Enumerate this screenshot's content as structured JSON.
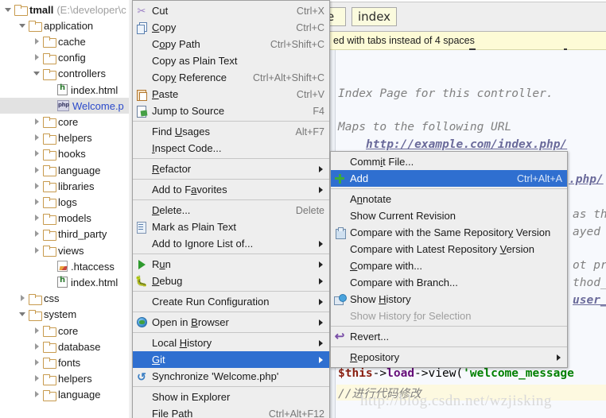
{
  "editor": {
    "tabs": [
      {
        "label": "e",
        "name": "tab-welcome-partial"
      },
      {
        "label": "index",
        "name": "tab-index"
      }
    ],
    "warning_strip": "ed with tabs instead of 4 spaces",
    "code_lines": [
      {
        "text": "Index Page for this controller.",
        "style": "plain"
      },
      {
        "text": "Maps to the following URL",
        "style": "plain"
      },
      {
        "text": "http://example.com/index.php/",
        "style": "link"
      },
      {
        "text": ".php/",
        "style": "link"
      },
      {
        "text": "as the",
        "style": "plain"
      },
      {
        "text": "ayed c",
        "style": "plain"
      },
      {
        "text": "ot pre",
        "style": "plain"
      },
      {
        "text": "thod_",
        "style": "plain"
      },
      {
        "text": "user_",
        "style": "link"
      }
    ],
    "php_code": {
      "var": "$this",
      "arrow1": "->",
      "kw": "load",
      "arrow2": "->",
      "method": "view(",
      "string": "'welcome_message"
    },
    "comment": "//进行代码修改",
    "watermark": "http://blog.csdn.net/wzjisking"
  },
  "tree": {
    "items": [
      {
        "indent": 0,
        "twisty": "open",
        "icon": "folder-icon",
        "label": "tmall",
        "path": "(E:\\developer\\c",
        "bold": true,
        "selected": false
      },
      {
        "indent": 1,
        "twisty": "open",
        "icon": "folder-icon",
        "label": "application",
        "path": "",
        "bold": false,
        "selected": false
      },
      {
        "indent": 2,
        "twisty": "closed",
        "icon": "folder-icon",
        "label": "cache",
        "path": "",
        "bold": false,
        "selected": false
      },
      {
        "indent": 2,
        "twisty": "closed",
        "icon": "folder-icon",
        "label": "config",
        "path": "",
        "bold": false,
        "selected": false
      },
      {
        "indent": 2,
        "twisty": "open",
        "icon": "folder-icon",
        "label": "controllers",
        "path": "",
        "bold": false,
        "selected": false
      },
      {
        "indent": 3,
        "twisty": "none",
        "icon": "html-file-icon",
        "label": "index.html",
        "path": "",
        "bold": false,
        "selected": false
      },
      {
        "indent": 3,
        "twisty": "none",
        "icon": "php-file-icon",
        "label": "Welcome.p",
        "path": "",
        "bold": false,
        "selected": true
      },
      {
        "indent": 2,
        "twisty": "closed",
        "icon": "folder-icon",
        "label": "core",
        "path": "",
        "bold": false,
        "selected": false
      },
      {
        "indent": 2,
        "twisty": "closed",
        "icon": "folder-icon",
        "label": "helpers",
        "path": "",
        "bold": false,
        "selected": false
      },
      {
        "indent": 2,
        "twisty": "closed",
        "icon": "folder-icon",
        "label": "hooks",
        "path": "",
        "bold": false,
        "selected": false
      },
      {
        "indent": 2,
        "twisty": "closed",
        "icon": "folder-icon",
        "label": "language",
        "path": "",
        "bold": false,
        "selected": false
      },
      {
        "indent": 2,
        "twisty": "closed",
        "icon": "folder-icon",
        "label": "libraries",
        "path": "",
        "bold": false,
        "selected": false
      },
      {
        "indent": 2,
        "twisty": "closed",
        "icon": "folder-icon",
        "label": "logs",
        "path": "",
        "bold": false,
        "selected": false
      },
      {
        "indent": 2,
        "twisty": "closed",
        "icon": "folder-icon",
        "label": "models",
        "path": "",
        "bold": false,
        "selected": false
      },
      {
        "indent": 2,
        "twisty": "closed",
        "icon": "folder-icon",
        "label": "third_party",
        "path": "",
        "bold": false,
        "selected": false
      },
      {
        "indent": 2,
        "twisty": "closed",
        "icon": "folder-icon",
        "label": "views",
        "path": "",
        "bold": false,
        "selected": false
      },
      {
        "indent": 3,
        "twisty": "none",
        "icon": "htaccess-file-icon",
        "label": ".htaccess",
        "path": "",
        "bold": false,
        "selected": false
      },
      {
        "indent": 3,
        "twisty": "none",
        "icon": "html-file-icon",
        "label": "index.html",
        "path": "",
        "bold": false,
        "selected": false
      },
      {
        "indent": 1,
        "twisty": "closed",
        "icon": "folder-icon",
        "label": "css",
        "path": "",
        "bold": false,
        "selected": false
      },
      {
        "indent": 1,
        "twisty": "open",
        "icon": "folder-icon",
        "label": "system",
        "path": "",
        "bold": false,
        "selected": false
      },
      {
        "indent": 2,
        "twisty": "closed",
        "icon": "folder-icon",
        "label": "core",
        "path": "",
        "bold": false,
        "selected": false
      },
      {
        "indent": 2,
        "twisty": "closed",
        "icon": "folder-icon",
        "label": "database",
        "path": "",
        "bold": false,
        "selected": false
      },
      {
        "indent": 2,
        "twisty": "closed",
        "icon": "folder-icon",
        "label": "fonts",
        "path": "",
        "bold": false,
        "selected": false
      },
      {
        "indent": 2,
        "twisty": "closed",
        "icon": "folder-icon",
        "label": "helpers",
        "path": "",
        "bold": false,
        "selected": false
      },
      {
        "indent": 2,
        "twisty": "closed",
        "icon": "folder-icon",
        "label": "language",
        "path": "",
        "bold": false,
        "selected": false
      }
    ]
  },
  "context_menu": {
    "items": [
      {
        "type": "item",
        "label": "Cut",
        "mnemonic": "",
        "shortcut": "Ctrl+X",
        "icon": "scissors-icon",
        "submenu": false,
        "highlight": false,
        "disabled": false
      },
      {
        "type": "item",
        "label": "Copy",
        "mnemonic": "C",
        "shortcut": "Ctrl+C",
        "icon": "copy-icon",
        "submenu": false,
        "highlight": false,
        "disabled": false
      },
      {
        "type": "item",
        "label": "Copy Path",
        "mnemonic": "o",
        "shortcut": "Ctrl+Shift+C",
        "icon": "",
        "submenu": false,
        "highlight": false,
        "disabled": false
      },
      {
        "type": "item",
        "label": "Copy as Plain Text",
        "mnemonic": "",
        "shortcut": "",
        "icon": "",
        "submenu": false,
        "highlight": false,
        "disabled": false
      },
      {
        "type": "item",
        "label": "Copy Reference",
        "mnemonic": "y",
        "shortcut": "Ctrl+Alt+Shift+C",
        "icon": "",
        "submenu": false,
        "highlight": false,
        "disabled": false
      },
      {
        "type": "item",
        "label": "Paste",
        "mnemonic": "P",
        "shortcut": "Ctrl+V",
        "icon": "paste-icon",
        "submenu": false,
        "highlight": false,
        "disabled": false
      },
      {
        "type": "item",
        "label": "Jump to Source",
        "mnemonic": "",
        "shortcut": "F4",
        "icon": "jump-to-source-icon",
        "submenu": false,
        "highlight": false,
        "disabled": false
      },
      {
        "type": "separator"
      },
      {
        "type": "item",
        "label": "Find Usages",
        "mnemonic": "U",
        "shortcut": "Alt+F7",
        "icon": "",
        "submenu": false,
        "highlight": false,
        "disabled": false
      },
      {
        "type": "item",
        "label": "Inspect Code...",
        "mnemonic": "I",
        "shortcut": "",
        "icon": "",
        "submenu": false,
        "highlight": false,
        "disabled": false
      },
      {
        "type": "separator"
      },
      {
        "type": "item",
        "label": "Refactor",
        "mnemonic": "R",
        "shortcut": "",
        "icon": "",
        "submenu": true,
        "highlight": false,
        "disabled": false
      },
      {
        "type": "separator"
      },
      {
        "type": "item",
        "label": "Add to Favorites",
        "mnemonic": "a",
        "shortcut": "",
        "icon": "",
        "submenu": true,
        "highlight": false,
        "disabled": false
      },
      {
        "type": "separator"
      },
      {
        "type": "item",
        "label": "Delete...",
        "mnemonic": "D",
        "shortcut": "Delete",
        "icon": "",
        "submenu": false,
        "highlight": false,
        "disabled": false
      },
      {
        "type": "item",
        "label": "Mark as Plain Text",
        "mnemonic": "",
        "shortcut": "",
        "icon": "mark-plain-text-icon",
        "submenu": false,
        "highlight": false,
        "disabled": false
      },
      {
        "type": "item",
        "label": "Add to Ignore List of...",
        "mnemonic": "",
        "shortcut": "",
        "icon": "",
        "submenu": true,
        "highlight": false,
        "disabled": false
      },
      {
        "type": "separator"
      },
      {
        "type": "item",
        "label": "Run",
        "mnemonic": "u",
        "shortcut": "",
        "icon": "run-icon",
        "submenu": true,
        "highlight": false,
        "disabled": false
      },
      {
        "type": "item",
        "label": "Debug",
        "mnemonic": "D",
        "shortcut": "",
        "icon": "debug-icon",
        "submenu": true,
        "highlight": false,
        "disabled": false
      },
      {
        "type": "separator"
      },
      {
        "type": "item",
        "label": "Create Run Configuration",
        "mnemonic": "",
        "shortcut": "",
        "icon": "",
        "submenu": true,
        "highlight": false,
        "disabled": false
      },
      {
        "type": "separator"
      },
      {
        "type": "item",
        "label": "Open in Browser",
        "mnemonic": "B",
        "shortcut": "",
        "icon": "browser-icon",
        "submenu": true,
        "highlight": false,
        "disabled": false
      },
      {
        "type": "separator"
      },
      {
        "type": "item",
        "label": "Local History",
        "mnemonic": "H",
        "shortcut": "",
        "icon": "",
        "submenu": true,
        "highlight": false,
        "disabled": false
      },
      {
        "type": "item",
        "label": "Git",
        "mnemonic": "G",
        "shortcut": "",
        "icon": "",
        "submenu": true,
        "highlight": true,
        "disabled": false
      },
      {
        "type": "item",
        "label": "Synchronize 'Welcome.php'",
        "mnemonic": "",
        "shortcut": "",
        "icon": "synchronize-icon",
        "submenu": false,
        "highlight": false,
        "disabled": false
      },
      {
        "type": "separator"
      },
      {
        "type": "item",
        "label": "Show in Explorer",
        "mnemonic": "",
        "shortcut": "",
        "icon": "",
        "submenu": false,
        "highlight": false,
        "disabled": false
      },
      {
        "type": "item",
        "label": "File Path",
        "mnemonic": "P",
        "shortcut": "Ctrl+Alt+F12",
        "icon": "",
        "submenu": false,
        "highlight": false,
        "disabled": false
      }
    ]
  },
  "git_submenu": {
    "items": [
      {
        "type": "item",
        "label": "Commit File...",
        "mnemonic": "i",
        "shortcut": "",
        "icon": "",
        "submenu": false,
        "highlight": false,
        "disabled": false
      },
      {
        "type": "item",
        "label": "Add",
        "mnemonic": "",
        "shortcut": "Ctrl+Alt+A",
        "icon": "add-icon",
        "submenu": false,
        "highlight": true,
        "disabled": false
      },
      {
        "type": "separator"
      },
      {
        "type": "item",
        "label": "Annotate",
        "mnemonic": "n",
        "shortcut": "",
        "icon": "",
        "submenu": false,
        "highlight": false,
        "disabled": false
      },
      {
        "type": "item",
        "label": "Show Current Revision",
        "mnemonic": "",
        "shortcut": "",
        "icon": "",
        "submenu": false,
        "highlight": false,
        "disabled": false
      },
      {
        "type": "item",
        "label": "Compare with the Same Repository Version",
        "mnemonic": "y",
        "shortcut": "",
        "icon": "compare-icon",
        "submenu": false,
        "highlight": false,
        "disabled": false
      },
      {
        "type": "item",
        "label": "Compare with Latest Repository Version",
        "mnemonic": "V",
        "shortcut": "",
        "icon": "",
        "submenu": false,
        "highlight": false,
        "disabled": false
      },
      {
        "type": "item",
        "label": "Compare with...",
        "mnemonic": "C",
        "shortcut": "",
        "icon": "",
        "submenu": false,
        "highlight": false,
        "disabled": false
      },
      {
        "type": "item",
        "label": "Compare with Branch...",
        "mnemonic": "",
        "shortcut": "",
        "icon": "",
        "submenu": false,
        "highlight": false,
        "disabled": false
      },
      {
        "type": "item",
        "label": "Show History",
        "mnemonic": "H",
        "shortcut": "",
        "icon": "show-history-icon",
        "submenu": false,
        "highlight": false,
        "disabled": false
      },
      {
        "type": "item",
        "label": "Show History for Selection",
        "mnemonic": "f",
        "shortcut": "",
        "icon": "",
        "submenu": false,
        "highlight": false,
        "disabled": true
      },
      {
        "type": "separator"
      },
      {
        "type": "item",
        "label": "Revert...",
        "mnemonic": "",
        "shortcut": "",
        "icon": "revert-icon",
        "submenu": false,
        "highlight": false,
        "disabled": false
      },
      {
        "type": "separator"
      },
      {
        "type": "item",
        "label": "Repository",
        "mnemonic": "R",
        "shortcut": "",
        "icon": "",
        "submenu": true,
        "highlight": false,
        "disabled": false
      }
    ]
  }
}
